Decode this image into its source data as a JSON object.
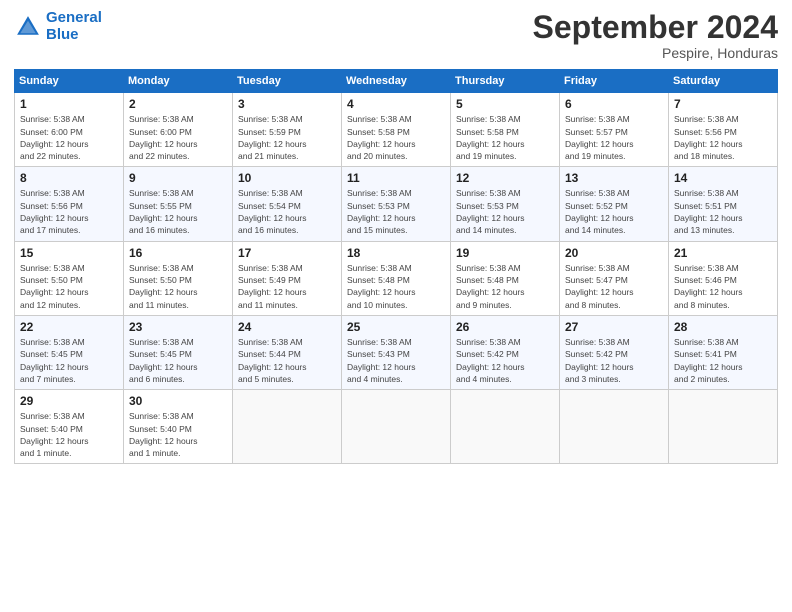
{
  "logo": {
    "text1": "General",
    "text2": "Blue"
  },
  "title": "September 2024",
  "subtitle": "Pespire, Honduras",
  "days_header": [
    "Sunday",
    "Monday",
    "Tuesday",
    "Wednesday",
    "Thursday",
    "Friday",
    "Saturday"
  ],
  "weeks": [
    [
      {
        "day": "1",
        "info": "Sunrise: 5:38 AM\nSunset: 6:00 PM\nDaylight: 12 hours\nand 22 minutes."
      },
      {
        "day": "2",
        "info": "Sunrise: 5:38 AM\nSunset: 6:00 PM\nDaylight: 12 hours\nand 22 minutes."
      },
      {
        "day": "3",
        "info": "Sunrise: 5:38 AM\nSunset: 5:59 PM\nDaylight: 12 hours\nand 21 minutes."
      },
      {
        "day": "4",
        "info": "Sunrise: 5:38 AM\nSunset: 5:58 PM\nDaylight: 12 hours\nand 20 minutes."
      },
      {
        "day": "5",
        "info": "Sunrise: 5:38 AM\nSunset: 5:58 PM\nDaylight: 12 hours\nand 19 minutes."
      },
      {
        "day": "6",
        "info": "Sunrise: 5:38 AM\nSunset: 5:57 PM\nDaylight: 12 hours\nand 19 minutes."
      },
      {
        "day": "7",
        "info": "Sunrise: 5:38 AM\nSunset: 5:56 PM\nDaylight: 12 hours\nand 18 minutes."
      }
    ],
    [
      {
        "day": "8",
        "info": "Sunrise: 5:38 AM\nSunset: 5:56 PM\nDaylight: 12 hours\nand 17 minutes."
      },
      {
        "day": "9",
        "info": "Sunrise: 5:38 AM\nSunset: 5:55 PM\nDaylight: 12 hours\nand 16 minutes."
      },
      {
        "day": "10",
        "info": "Sunrise: 5:38 AM\nSunset: 5:54 PM\nDaylight: 12 hours\nand 16 minutes."
      },
      {
        "day": "11",
        "info": "Sunrise: 5:38 AM\nSunset: 5:53 PM\nDaylight: 12 hours\nand 15 minutes."
      },
      {
        "day": "12",
        "info": "Sunrise: 5:38 AM\nSunset: 5:53 PM\nDaylight: 12 hours\nand 14 minutes."
      },
      {
        "day": "13",
        "info": "Sunrise: 5:38 AM\nSunset: 5:52 PM\nDaylight: 12 hours\nand 14 minutes."
      },
      {
        "day": "14",
        "info": "Sunrise: 5:38 AM\nSunset: 5:51 PM\nDaylight: 12 hours\nand 13 minutes."
      }
    ],
    [
      {
        "day": "15",
        "info": "Sunrise: 5:38 AM\nSunset: 5:50 PM\nDaylight: 12 hours\nand 12 minutes."
      },
      {
        "day": "16",
        "info": "Sunrise: 5:38 AM\nSunset: 5:50 PM\nDaylight: 12 hours\nand 11 minutes."
      },
      {
        "day": "17",
        "info": "Sunrise: 5:38 AM\nSunset: 5:49 PM\nDaylight: 12 hours\nand 11 minutes."
      },
      {
        "day": "18",
        "info": "Sunrise: 5:38 AM\nSunset: 5:48 PM\nDaylight: 12 hours\nand 10 minutes."
      },
      {
        "day": "19",
        "info": "Sunrise: 5:38 AM\nSunset: 5:48 PM\nDaylight: 12 hours\nand 9 minutes."
      },
      {
        "day": "20",
        "info": "Sunrise: 5:38 AM\nSunset: 5:47 PM\nDaylight: 12 hours\nand 8 minutes."
      },
      {
        "day": "21",
        "info": "Sunrise: 5:38 AM\nSunset: 5:46 PM\nDaylight: 12 hours\nand 8 minutes."
      }
    ],
    [
      {
        "day": "22",
        "info": "Sunrise: 5:38 AM\nSunset: 5:45 PM\nDaylight: 12 hours\nand 7 minutes."
      },
      {
        "day": "23",
        "info": "Sunrise: 5:38 AM\nSunset: 5:45 PM\nDaylight: 12 hours\nand 6 minutes."
      },
      {
        "day": "24",
        "info": "Sunrise: 5:38 AM\nSunset: 5:44 PM\nDaylight: 12 hours\nand 5 minutes."
      },
      {
        "day": "25",
        "info": "Sunrise: 5:38 AM\nSunset: 5:43 PM\nDaylight: 12 hours\nand 4 minutes."
      },
      {
        "day": "26",
        "info": "Sunrise: 5:38 AM\nSunset: 5:42 PM\nDaylight: 12 hours\nand 4 minutes."
      },
      {
        "day": "27",
        "info": "Sunrise: 5:38 AM\nSunset: 5:42 PM\nDaylight: 12 hours\nand 3 minutes."
      },
      {
        "day": "28",
        "info": "Sunrise: 5:38 AM\nSunset: 5:41 PM\nDaylight: 12 hours\nand 2 minutes."
      }
    ],
    [
      {
        "day": "29",
        "info": "Sunrise: 5:38 AM\nSunset: 5:40 PM\nDaylight: 12 hours\nand 1 minute."
      },
      {
        "day": "30",
        "info": "Sunrise: 5:38 AM\nSunset: 5:40 PM\nDaylight: 12 hours\nand 1 minute."
      },
      {
        "day": "",
        "info": ""
      },
      {
        "day": "",
        "info": ""
      },
      {
        "day": "",
        "info": ""
      },
      {
        "day": "",
        "info": ""
      },
      {
        "day": "",
        "info": ""
      }
    ]
  ]
}
